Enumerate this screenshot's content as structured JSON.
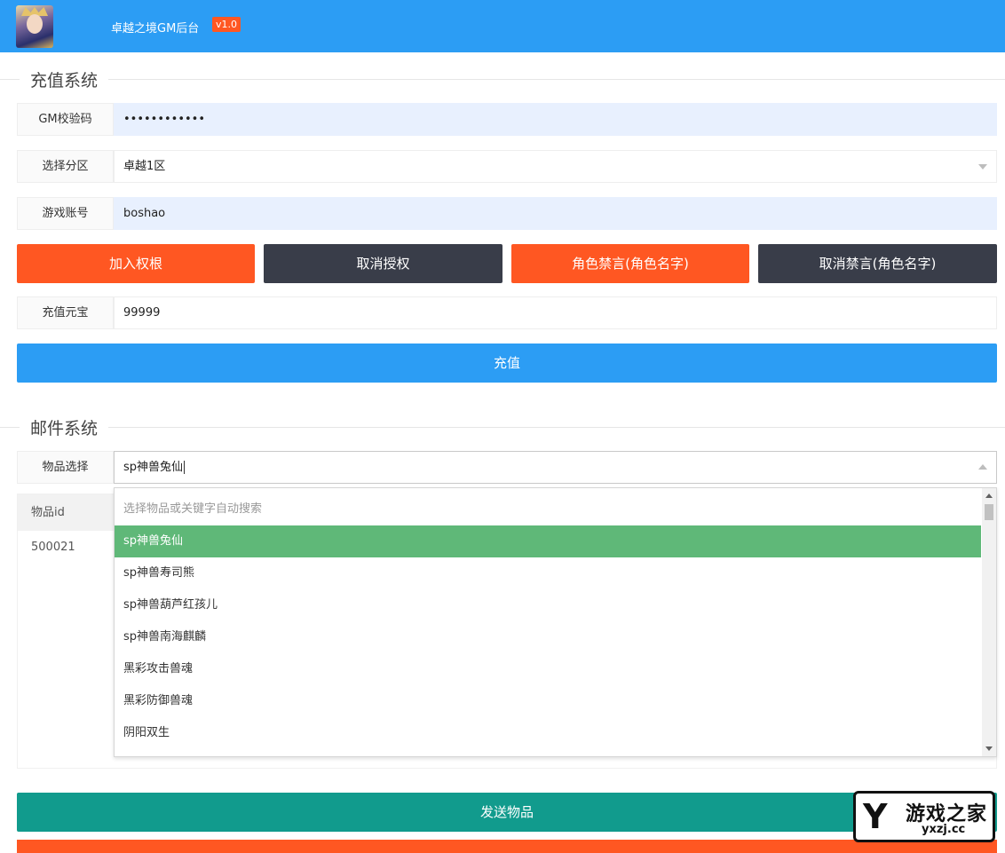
{
  "header": {
    "title": "卓越之境GM后台",
    "version": "v1.0",
    "avatar_icon": "game-character-avatar"
  },
  "recharge": {
    "section_title": "充值系统",
    "gm_code": {
      "label": "GM校验码",
      "value": "••••••••••••"
    },
    "zone": {
      "label": "选择分区",
      "value": "卓越1区"
    },
    "account": {
      "label": "游戏账号",
      "value": "boshao"
    },
    "buttons": {
      "add_permission": "加入权根",
      "revoke_permission": "取消授权",
      "mute_role": "角色禁言(角色名字)",
      "unmute_role": "取消禁言(角色名字)"
    },
    "ingot": {
      "label": "充值元宝",
      "value": "99999"
    },
    "submit_label": "充值"
  },
  "mail": {
    "section_title": "邮件系统",
    "item_select": {
      "label": "物品选择",
      "value": "sp神兽兔仙"
    },
    "dropdown": {
      "placeholder": "选择物品或关键字自动搜索",
      "options": [
        "sp神兽兔仙",
        "sp神兽寿司熊",
        "sp神兽葫芦红孩儿",
        "sp神兽南海麒麟",
        "黑彩攻击兽魂",
        "黑彩防御兽魂",
        "阴阳双生"
      ],
      "selected_index": 0
    },
    "table": {
      "header": "物品id",
      "value": "500021"
    },
    "send_label": "发送物品"
  },
  "watermark": {
    "name": "游戏之家",
    "url": "yxzj.cc"
  },
  "colors": {
    "header_blue": "#2c9df4",
    "orange": "#ff5722",
    "dark": "#393d49",
    "teal": "#119b8d",
    "selected_green": "#5fb878"
  }
}
